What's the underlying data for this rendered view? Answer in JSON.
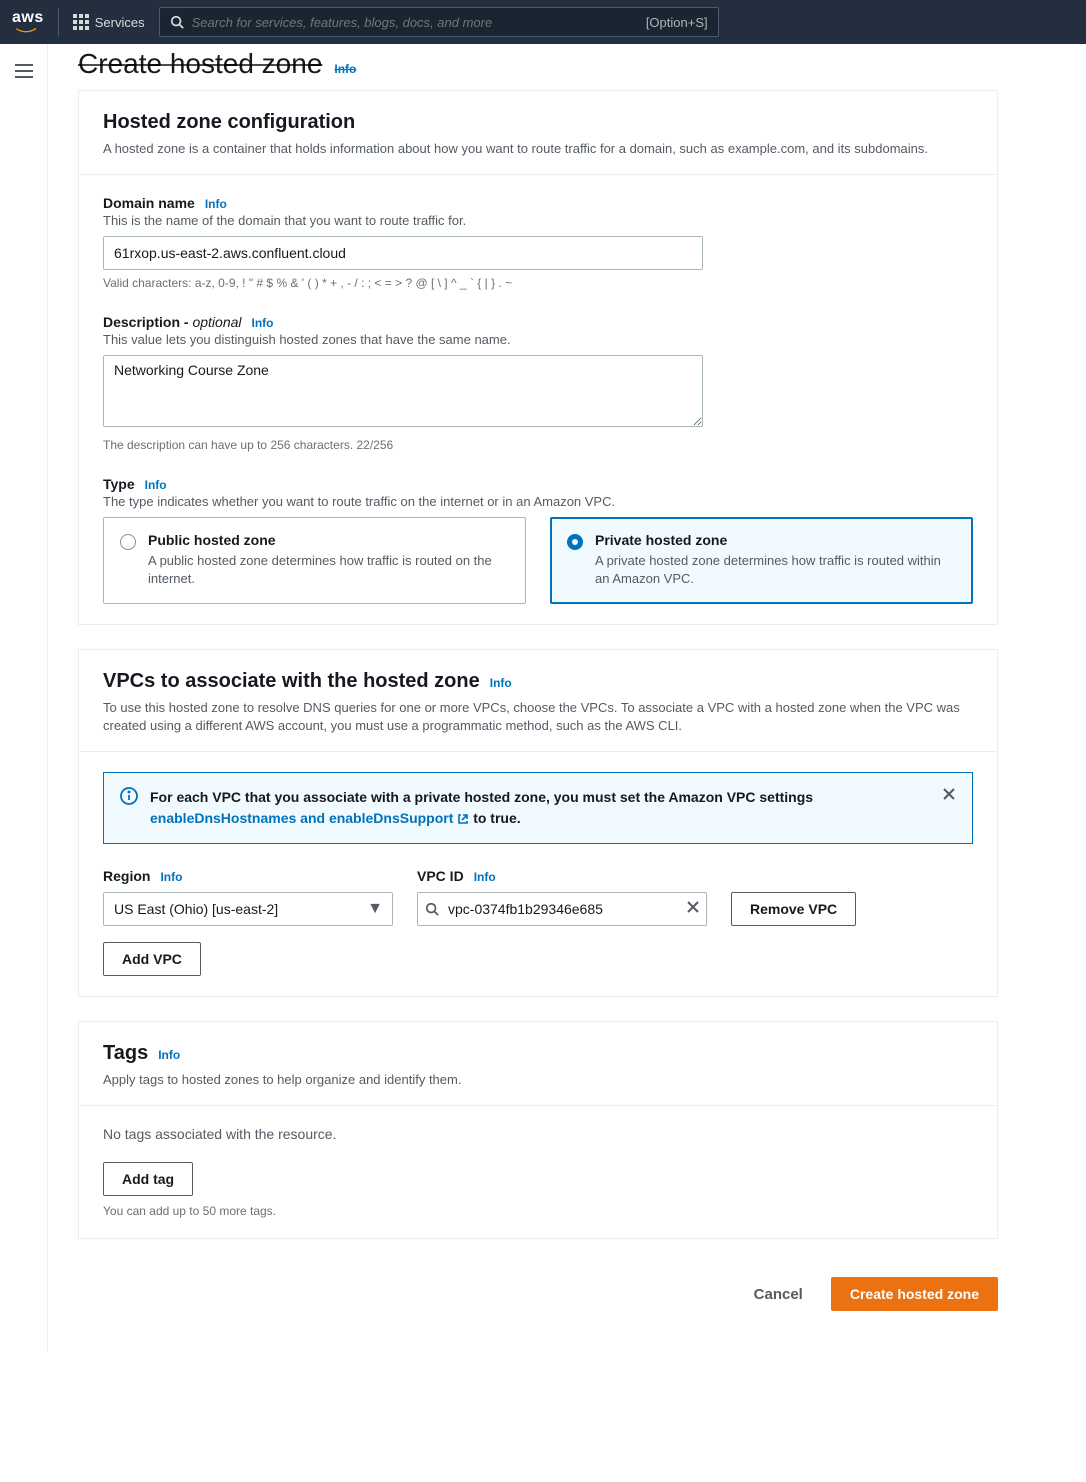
{
  "topbar": {
    "services": "Services",
    "search_placeholder": "Search for services, features, blogs, docs, and more",
    "shortcut": "[Option+S]"
  },
  "page": {
    "title": "Create hosted zone",
    "info": "Info"
  },
  "config": {
    "title": "Hosted zone configuration",
    "desc": "A hosted zone is a container that holds information about how you want to route traffic for a domain, such as example.com, and its subdomains.",
    "domain": {
      "label": "Domain name",
      "info": "Info",
      "hint": "This is the name of the domain that you want to route traffic for.",
      "value": "61rxop.us-east-2.aws.confluent.cloud",
      "constraint": "Valid characters: a-z, 0-9, ! \" # $ % & ' ( ) * + , - / : ; < = > ? @ [ \\ ] ^ _ ` { | } . ~"
    },
    "description": {
      "label": "Description - ",
      "optional": "optional",
      "info": "Info",
      "hint": "This value lets you distinguish hosted zones that have the same name.",
      "value": "Networking Course Zone",
      "constraint": "The description can have up to 256 characters. 22/256"
    },
    "type": {
      "label": "Type",
      "info": "Info",
      "hint": "The type indicates whether you want to route traffic on the internet or in an Amazon VPC.",
      "public": {
        "title": "Public hosted zone",
        "desc": "A public hosted zone determines how traffic is routed on the internet."
      },
      "private": {
        "title": "Private hosted zone",
        "desc": "A private hosted zone determines how traffic is routed within an Amazon VPC."
      }
    }
  },
  "vpcs": {
    "title": "VPCs to associate with the hosted zone",
    "info": "Info",
    "desc": "To use this hosted zone to resolve DNS queries for one or more VPCs, choose the VPCs. To associate a VPC with a hosted zone when the VPC was created using a different AWS account, you must use a programmatic method, such as the AWS CLI.",
    "alert": {
      "line1": "For each VPC that you associate with a private hosted zone, you must set the Amazon VPC settings ",
      "link": "enableDnsHostnames and enableDnsSupport",
      "line2": " to true."
    },
    "region": {
      "label": "Region",
      "info": "Info",
      "value": "US East (Ohio) [us-east-2]"
    },
    "vpcid": {
      "label": "VPC ID",
      "info": "Info",
      "value": "vpc-0374fb1b29346e685"
    },
    "remove": "Remove VPC",
    "add": "Add VPC"
  },
  "tags": {
    "title": "Tags",
    "info": "Info",
    "desc": "Apply tags to hosted zones to help organize and identify them.",
    "empty": "No tags associated with the resource.",
    "add": "Add tag",
    "constraint": "You can add up to 50 more tags."
  },
  "footer": {
    "cancel": "Cancel",
    "create": "Create hosted zone"
  }
}
